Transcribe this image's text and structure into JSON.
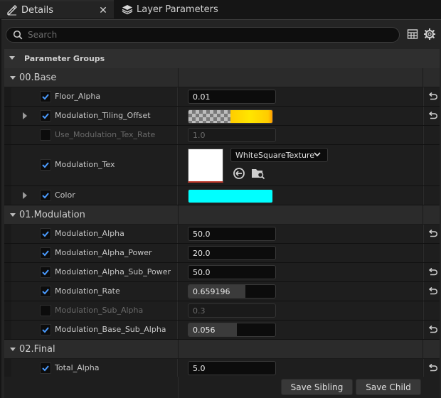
{
  "tabs": [
    {
      "label": "Details",
      "icon": "pencil-icon",
      "active": true
    },
    {
      "label": "Layer Parameters",
      "icon": "layers-icon",
      "active": false
    }
  ],
  "search": {
    "placeholder": "Search",
    "value": ""
  },
  "toolbar": {
    "table_icon": "table-view-icon",
    "settings_icon": "gear-icon"
  },
  "section_header": "Parameter Groups",
  "groups": [
    {
      "name": "00.Base",
      "params": [
        {
          "name": "Floor_Alpha",
          "checked": true,
          "value": "0.01",
          "reset": true
        },
        {
          "name": "Modulation_Tiling_Offset",
          "checked": true,
          "type": "vector",
          "expandable": true,
          "reset": true
        },
        {
          "name": "Use_Modulation_Tex_Rate",
          "checked": false,
          "value": "1.0",
          "reset": false
        },
        {
          "name": "Modulation_Tex",
          "checked": true,
          "type": "texture",
          "texture": "WhiteSquareTexture",
          "reset": false
        },
        {
          "name": "Color",
          "checked": true,
          "type": "color",
          "color": "#00ffff",
          "expandable": true,
          "reset": false
        }
      ]
    },
    {
      "name": "01.Modulation",
      "params": [
        {
          "name": "Modulation_Alpha",
          "checked": true,
          "value": "50.0",
          "reset": true
        },
        {
          "name": "Modulation_Alpha_Power",
          "checked": true,
          "value": "20.0",
          "reset": false
        },
        {
          "name": "Modulation_Alpha_Sub_Power",
          "checked": true,
          "value": "50.0",
          "reset": true
        },
        {
          "name": "Modulation_Rate",
          "checked": true,
          "value": "0.659196",
          "slider": 0.659196,
          "reset": true
        },
        {
          "name": "Modulation_Sub_Alpha",
          "checked": false,
          "value": "0.3",
          "reset": false
        },
        {
          "name": "Modulation_Base_Sub_Alpha",
          "checked": true,
          "value": "0.056",
          "slider": 0.56,
          "reset": true
        }
      ]
    },
    {
      "name": "02.Final",
      "params": [
        {
          "name": "Total_Alpha",
          "checked": true,
          "value": "5.0",
          "reset": true
        }
      ]
    }
  ],
  "buttons": {
    "save_sibling": "Save Sibling",
    "save_child": "Save Child"
  },
  "colors": {
    "accent": "#1f6fd6",
    "cyan": "#00ffff",
    "yellow": "#ffd700"
  }
}
